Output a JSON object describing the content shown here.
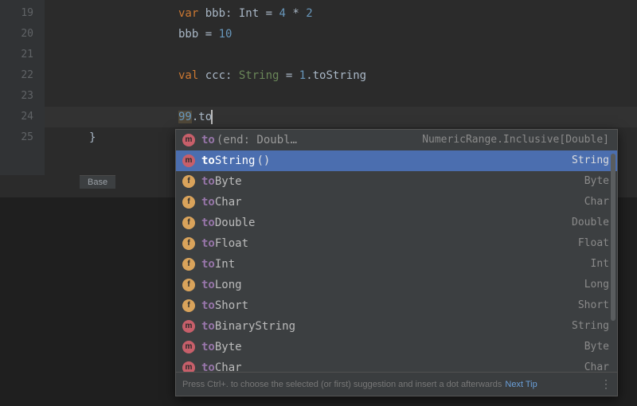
{
  "gutter": {
    "l19": "19",
    "l20": "20",
    "l21": "21",
    "l22": "22",
    "l23": "23",
    "l24": "24",
    "l25": "25"
  },
  "code": {
    "l19": {
      "kw": "var",
      "name": " bbb: ",
      "type": "Int",
      "eq": " = ",
      "a": "4",
      "op": " * ",
      "b": "2"
    },
    "l20": {
      "name": "bbb = ",
      "val": "10"
    },
    "l22": {
      "kw": "val",
      "name": " ccc: ",
      "type": "String",
      "eq": " = ",
      "a": "1",
      "dot": ".",
      "call": "toString"
    },
    "l24": {
      "num": "99",
      "dot": ".",
      "typed": "to"
    },
    "l25": {
      "brace": "}"
    }
  },
  "base_tab": "Base",
  "popup": {
    "items": [
      {
        "icon": "m",
        "match": "to",
        "rest": "",
        "sig": "(end: Doubl…",
        "ret": "NumericRange.Inclusive[Double]",
        "selected": false
      },
      {
        "icon": "m",
        "match": "to",
        "rest": "String",
        "sig": "()",
        "ret": "String",
        "selected": true
      },
      {
        "icon": "f",
        "match": "to",
        "rest": "Byte",
        "sig": "",
        "ret": "Byte"
      },
      {
        "icon": "f",
        "match": "to",
        "rest": "Char",
        "sig": "",
        "ret": "Char"
      },
      {
        "icon": "f",
        "match": "to",
        "rest": "Double",
        "sig": "",
        "ret": "Double"
      },
      {
        "icon": "f",
        "match": "to",
        "rest": "Float",
        "sig": "",
        "ret": "Float"
      },
      {
        "icon": "f",
        "match": "to",
        "rest": "Int",
        "sig": "",
        "ret": "Int"
      },
      {
        "icon": "f",
        "match": "to",
        "rest": "Long",
        "sig": "",
        "ret": "Long"
      },
      {
        "icon": "f",
        "match": "to",
        "rest": "Short",
        "sig": "",
        "ret": "Short"
      },
      {
        "icon": "m",
        "match": "to",
        "rest": "BinaryString",
        "sig": "",
        "ret": "String"
      },
      {
        "icon": "m",
        "match": "to",
        "rest": "Byte",
        "sig": "",
        "ret": "Byte"
      },
      {
        "icon": "m",
        "match": "to",
        "rest": "Char",
        "sig": "",
        "ret": "Char"
      }
    ],
    "hint": "Press Ctrl+. to choose the selected (or first) suggestion and insert a dot afterwards",
    "hint_link": "Next Tip"
  }
}
